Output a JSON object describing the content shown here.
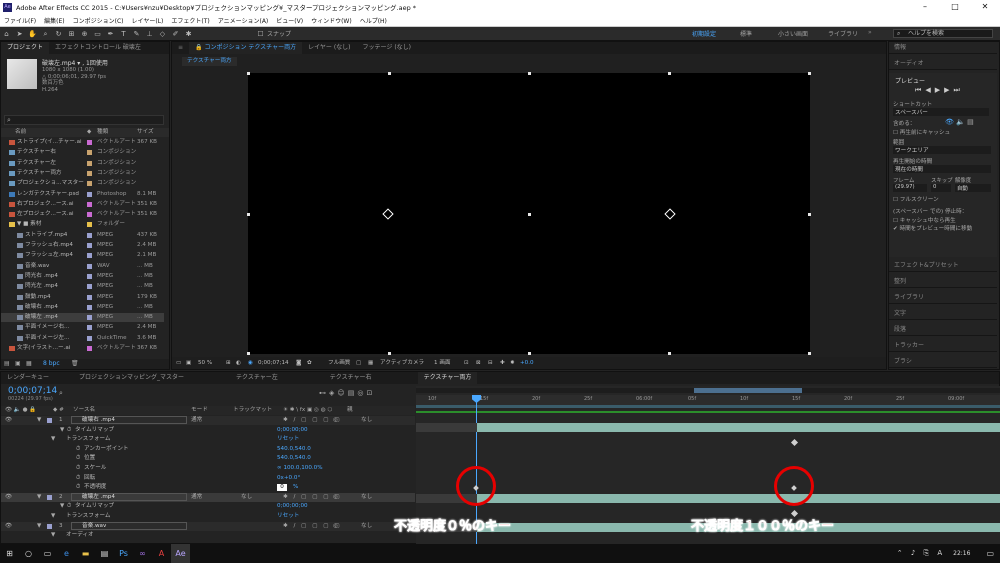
{
  "window": {
    "title": "Adobe After Effects CC 2015 - C:¥Users¥nzu¥Desktop¥プロジェクションマッピング¥_マスタープロジェクションマッピング.aep *",
    "app_badge": "Ae"
  },
  "menu": [
    "ファイル(F)",
    "編集(E)",
    "コンポジション(C)",
    "レイヤー(L)",
    "エフェクト(T)",
    "アニメーション(A)",
    "ビュー(V)",
    "ウィンドウ(W)",
    "ヘルプ(H)"
  ],
  "toolbar": {
    "snap_label": "スナップ",
    "workspaces": [
      "初期設定",
      "標準",
      "小さい画面",
      "ライブラリ"
    ],
    "search_placeholder": "ヘルプを検索"
  },
  "project": {
    "tabs": [
      "プロジェクト",
      "エフェクトコントロール 破壊左"
    ],
    "item_name": "破壊左.mp4 ▾ , 1回使用",
    "item_info": [
      "1080 x 1080 (1.00)",
      "△ 0;00;06;01, 29.97 fps",
      "数百万色",
      "H.264"
    ],
    "columns": [
      "名前",
      "種類",
      "サイズ"
    ],
    "rows": [
      {
        "name": "ストライプ(イ...チャー.ai",
        "type": "ベクトルアート",
        "size": "367 KB",
        "color": "#c96ad2",
        "icon": "#c8553d"
      },
      {
        "name": "テクスチャー右",
        "type": "コンポジション",
        "size": "",
        "color": "#c9a36e",
        "icon": "#6a9ac0"
      },
      {
        "name": "テクスチャー左",
        "type": "コンポジション",
        "size": "",
        "color": "#c9a36e",
        "icon": "#6a9ac0"
      },
      {
        "name": "テクスチャー両方",
        "type": "コンポジション",
        "size": "",
        "color": "#c9a36e",
        "icon": "#6a9ac0"
      },
      {
        "name": "プロジェクショ...マスター",
        "type": "コンポジション",
        "size": "",
        "color": "#c9a36e",
        "icon": "#6a9ac0"
      },
      {
        "name": "レンガテクスチャー.psd",
        "type": "Photoshop",
        "size": "8.1 MB",
        "color": "#9aa0cf",
        "icon": "#3d7ab8"
      },
      {
        "name": "右プロジェク...ース.ai",
        "type": "ベクトルアート",
        "size": "351 KB",
        "color": "#c96ad2",
        "icon": "#c8553d"
      },
      {
        "name": "左プロジェク...ース.ai",
        "type": "ベクトルアート",
        "size": "351 KB",
        "color": "#c96ad2",
        "icon": "#c8553d"
      },
      {
        "name": "▼ ■ 素材",
        "type": "フォルダー",
        "size": "",
        "color": "#e6c04a",
        "icon": "#e6c04a"
      },
      {
        "name": "ストライプ.mp4",
        "type": "MPEG",
        "size": "437 KB",
        "color": "#9aa0cf",
        "icon": "#7e8aa0"
      },
      {
        "name": "フラッシュ右.mp4",
        "type": "MPEG",
        "size": "2.4 MB",
        "color": "#9aa0cf",
        "icon": "#7e8aa0"
      },
      {
        "name": "フラッシュ左.mp4",
        "type": "MPEG",
        "size": "2.1 MB",
        "color": "#9aa0cf",
        "icon": "#7e8aa0"
      },
      {
        "name": "音楽.wav",
        "type": "WAV",
        "size": "... MB",
        "color": "#9aa0cf",
        "icon": "#7e8aa0"
      },
      {
        "name": "閃光右 .mp4",
        "type": "MPEG",
        "size": "... MB",
        "color": "#9aa0cf",
        "icon": "#7e8aa0"
      },
      {
        "name": "閃光左 .mp4",
        "type": "MPEG",
        "size": "... MB",
        "color": "#9aa0cf",
        "icon": "#7e8aa0"
      },
      {
        "name": "鼓動.mp4",
        "type": "MPEG",
        "size": "179 KB",
        "color": "#9aa0cf",
        "icon": "#7e8aa0"
      },
      {
        "name": "破壊右 .mp4",
        "type": "MPEG",
        "size": "... MB",
        "color": "#9aa0cf",
        "icon": "#7e8aa0"
      },
      {
        "name": "破壊左 .mp4",
        "type": "MPEG",
        "size": "... MB",
        "color": "#9aa0cf",
        "icon": "#7e8aa0",
        "selected": true
      },
      {
        "name": "平面イメージ右...",
        "type": "MPEG",
        "size": "2.4 MB",
        "color": "#9aa0cf",
        "icon": "#7e8aa0"
      },
      {
        "name": "平面イメージ左...",
        "type": "QuickTime",
        "size": "3.6 MB",
        "color": "#9aa0cf",
        "icon": "#7e8aa0"
      },
      {
        "name": "文字(イラスト...ー.ai",
        "type": "ベクトルアート",
        "size": "367 KB",
        "color": "#c96ad2",
        "icon": "#c8553d"
      }
    ],
    "bpc": "8 bpc"
  },
  "viewer": {
    "tabs": [
      "コンポジション テクスチャー両方",
      "レイヤー (なし)",
      "フッテージ (なし)"
    ],
    "breadcrumb": "テクスチャー両方",
    "zoom": "50 %",
    "timecode": "0;00;07;14",
    "resolution": "フル画質",
    "camera": "アクティブカメラ",
    "views": "1 画面",
    "exposure": "+0.0"
  },
  "right_panel": {
    "top_items": [
      "情報",
      "オーディオ"
    ],
    "preview_title": "プレビュー",
    "shortcut_label": "ショートカット",
    "shortcut_value": "スペースバー",
    "include_label": "含める：",
    "cache_label": "再生前にキャッシュ",
    "range_label": "範囲",
    "range_value": "ワークエリア",
    "start_label": "再生開始の時間",
    "start_value": "現在の時間",
    "frame_label": "フレーム",
    "skip_label": "スキップ",
    "res_label": "解像度",
    "frame_value": "(29.97)",
    "skip_value": "0",
    "res_value": "自動",
    "fullscreen_label": "フルスクリーン",
    "stop_label": "(スペースバー での) 停止時：",
    "cache_stop_label": "キャッシュ中なら再生",
    "move_label": "時間をプレビュー時間に移動",
    "sections": [
      "エフェクト&プリセット",
      "整列",
      "ライブラリ",
      "文字",
      "段落",
      "トラッカー",
      "ブラシ"
    ]
  },
  "timeline": {
    "tabs": [
      "レンダーキュー",
      "プロジェクションマッピング_マスター",
      "テクスチャー左",
      "テクスチャー右",
      "テクスチャー両方"
    ],
    "timecode": "0;00;07;14",
    "frame_info": "00224 (29.97 fps)",
    "col_source": "ソース名",
    "col_mode": "モード",
    "col_trkmat": "トラックマット",
    "col_parent": "親",
    "ruler": [
      "10f",
      "15f",
      "20f",
      "25f",
      "06:00f",
      "05f",
      "10f",
      "15f",
      "20f",
      "25f",
      "09:00f"
    ],
    "rows": [
      {
        "type": "layer",
        "num": "1",
        "name": "破壊右 .mp4",
        "mode": "通常",
        "trk": "",
        "parent": "なし"
      },
      {
        "type": "prop",
        "indent": 2,
        "name": "タイムリマップ",
        "value": "0;00;00;00"
      },
      {
        "type": "prop",
        "indent": 1,
        "name": "トランスフォーム",
        "value": "リセット"
      },
      {
        "type": "prop",
        "indent": 3,
        "name": "アンカーポイント",
        "value": "540.0,540.0"
      },
      {
        "type": "prop",
        "indent": 3,
        "name": "位置",
        "value": "540.0,540.0"
      },
      {
        "type": "prop",
        "indent": 3,
        "name": "スケール",
        "value": "∞ 100.0,100.0%"
      },
      {
        "type": "prop",
        "indent": 3,
        "name": "回転",
        "value": "0x+0.0°"
      },
      {
        "type": "prop",
        "indent": 3,
        "name": "不透明度",
        "value": "0",
        "unit": "%",
        "editing": true
      },
      {
        "type": "layer",
        "num": "2",
        "name": "破壊左 .mp4",
        "mode": "通常",
        "trk": "なし",
        "parent": "なし",
        "selected": true
      },
      {
        "type": "prop",
        "indent": 2,
        "name": "タイムリマップ",
        "value": "0;00;00;00"
      },
      {
        "type": "prop",
        "indent": 1,
        "name": "トランスフォーム",
        "value": "リセット"
      },
      {
        "type": "layer",
        "num": "3",
        "name": "音楽.wav",
        "mode": "",
        "trk": "",
        "parent": "なし"
      },
      {
        "type": "prop",
        "indent": 1,
        "name": "オーディオ",
        "value": ""
      }
    ]
  },
  "annotations": {
    "left": "不透明度０％のキー",
    "right": "不透明度１００％のキー"
  },
  "taskbar": {
    "time": "22:16"
  }
}
